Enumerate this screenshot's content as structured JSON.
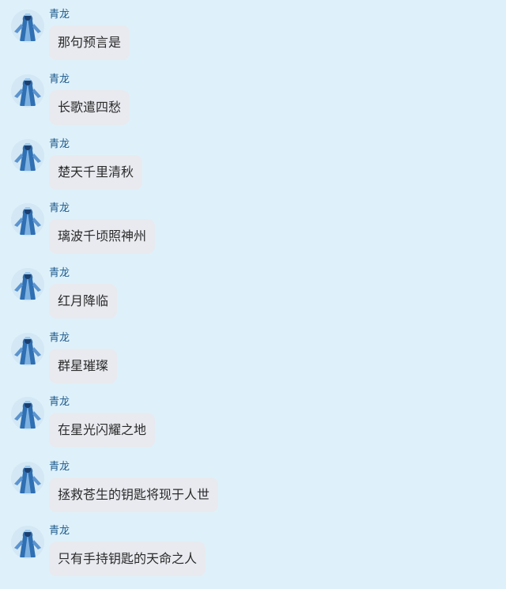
{
  "chat": {
    "messages": [
      {
        "sender": "青龙",
        "avatar_icon": "character-avatar-icon",
        "text": "那句预言是"
      },
      {
        "sender": "青龙",
        "avatar_icon": "character-avatar-icon",
        "text": "长歌遣四愁"
      },
      {
        "sender": "青龙",
        "avatar_icon": "character-avatar-icon",
        "text": "楚天千里清秋"
      },
      {
        "sender": "青龙",
        "avatar_icon": "character-avatar-icon",
        "text": "璃波千顷照神州"
      },
      {
        "sender": "青龙",
        "avatar_icon": "character-avatar-icon",
        "text": "红月降临"
      },
      {
        "sender": "青龙",
        "avatar_icon": "character-avatar-icon",
        "text": "群星璀璨"
      },
      {
        "sender": "青龙",
        "avatar_icon": "character-avatar-icon",
        "text": "在星光闪耀之地"
      },
      {
        "sender": "青龙",
        "avatar_icon": "character-avatar-icon",
        "text": "拯救苍生的钥匙将现于人世"
      },
      {
        "sender": "青龙",
        "avatar_icon": "character-avatar-icon",
        "text": "只有手持钥匙的天命之人"
      }
    ]
  },
  "colors": {
    "background": "#def1fa",
    "bubble": "#e8eaef",
    "sender_name": "#1f5a8c",
    "message_text": "#2b2b2b"
  }
}
